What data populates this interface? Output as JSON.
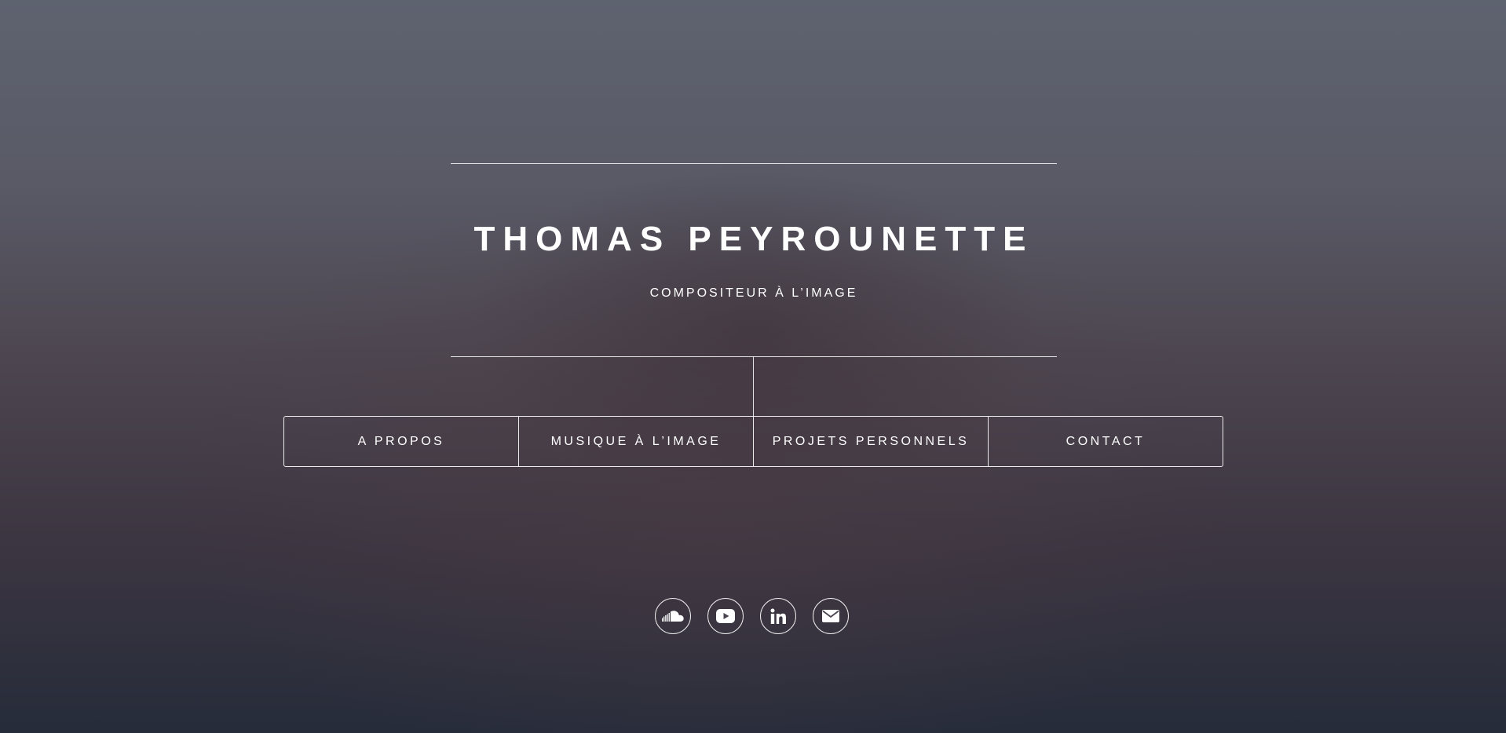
{
  "header": {
    "title": "THOMAS PEYROUNETTE",
    "subtitle": "COMPOSITEUR À L’IMAGE"
  },
  "nav": {
    "items": [
      {
        "label": "A PROPOS"
      },
      {
        "label": "MUSIQUE À L’IMAGE"
      },
      {
        "label": "PROJETS PERSONNELS"
      },
      {
        "label": "CONTACT"
      }
    ]
  },
  "social": {
    "links": [
      {
        "icon": "soundcloud-icon"
      },
      {
        "icon": "youtube-icon"
      },
      {
        "icon": "linkedin-icon"
      },
      {
        "icon": "envelope-icon"
      }
    ]
  },
  "colors": {
    "text": "#ffffff",
    "background_top": "#5e6370",
    "background_bottom": "#262c3a"
  }
}
